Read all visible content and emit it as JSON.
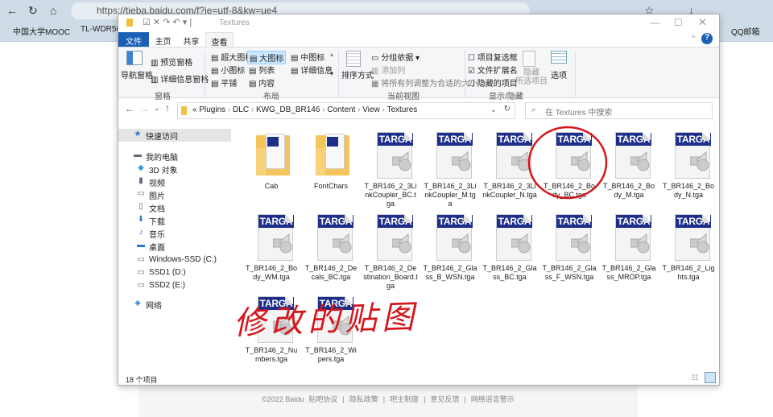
{
  "browser": {
    "url": "https://tieba.baidu.com/f?ie=utf-8&kw=ue4",
    "bookmarks": [
      "中国大学MOOC",
      "TL-WDR562",
      "QQ邮箱"
    ]
  },
  "footer": {
    "items": [
      "©2022 Baidu",
      "贴吧协议",
      "|",
      "隐私政策",
      "|",
      "吧主制度",
      "|",
      "意见反馈",
      "|",
      "网络谣言警示"
    ]
  },
  "explorer": {
    "title": "Textures",
    "tabs": [
      "文件",
      "主页",
      "共享",
      "查看"
    ],
    "ribbon": {
      "pane": {
        "nav": "导航窗格",
        "preview": "预览窗格",
        "details": "详细信息窗格",
        "group": "窗格"
      },
      "layout": {
        "items": [
          "超大图标",
          "大图标",
          "中图标",
          "小图标",
          "列表",
          "详细信息",
          "平铺",
          "内容"
        ],
        "selected": "大图标",
        "group": "布局"
      },
      "view": {
        "sort": "排序方式",
        "groupby": "分组依据",
        "addcol": "添加列",
        "fitcols": "将所有列调整为合适的大小",
        "group": "当前视图"
      },
      "show": {
        "checkboxes": "项目复选框",
        "extensions": "文件扩展名",
        "hidden": "隐藏的项目",
        "hide_selected": "隐藏\n所选项目",
        "options": "选项",
        "group": "显示/隐藏",
        "checked": {
          "checkboxes": false,
          "extensions": true,
          "hidden": false
        }
      }
    },
    "path": [
      "«",
      "Plugins",
      "DLC",
      "KWG_DB_BR146",
      "Content",
      "View",
      "Textures"
    ],
    "search_placeholder": "在 Textures 中搜索",
    "nav": [
      {
        "label": "快速访问",
        "icon": "star-icon"
      },
      {
        "label": "我的电脑",
        "icon": "computer-icon"
      },
      {
        "label": "3D 对象",
        "icon": "cube-icon"
      },
      {
        "label": "视频",
        "icon": "video-icon"
      },
      {
        "label": "图片",
        "icon": "picture-icon"
      },
      {
        "label": "文档",
        "icon": "document-icon"
      },
      {
        "label": "下载",
        "icon": "download-icon"
      },
      {
        "label": "音乐",
        "icon": "music-icon"
      },
      {
        "label": "桌面",
        "icon": "desktop-icon"
      },
      {
        "label": "Windows-SSD (C:)",
        "icon": "drive-icon"
      },
      {
        "label": "SSD1 (D:)",
        "icon": "drive-icon"
      },
      {
        "label": "SSD2 (E:)",
        "icon": "drive-icon"
      },
      {
        "label": "网络",
        "icon": "network-icon"
      }
    ],
    "files": [
      {
        "name": "Cab",
        "type": "folder"
      },
      {
        "name": "FontChars",
        "type": "folder"
      },
      {
        "name": "T_BR146_2_3LinkCoupler_BC.tga",
        "type": "targa"
      },
      {
        "name": "T_BR146_2_3LinkCoupler_M.tga",
        "type": "targa"
      },
      {
        "name": "T_BR146_2_3LinkCoupler_N.tga",
        "type": "targa"
      },
      {
        "name": "T_BR146_2_Body_BC.tga",
        "type": "targa",
        "circled": true
      },
      {
        "name": "T_BR146_2_Body_M.tga",
        "type": "targa"
      },
      {
        "name": "T_BR146_2_Body_N.tga",
        "type": "targa"
      },
      {
        "name": "T_BR146_2_Body_WM.tga",
        "type": "targa"
      },
      {
        "name": "T_BR146_2_Decals_BC.tga",
        "type": "targa"
      },
      {
        "name": "T_BR146_2_Destination_Board.tga",
        "type": "targa"
      },
      {
        "name": "T_BR146_2_Glass_B_WSN.tga",
        "type": "targa"
      },
      {
        "name": "T_BR146_2_Glass_BC.tga",
        "type": "targa"
      },
      {
        "name": "T_BR146_2_Glass_F_WSN.tga",
        "type": "targa"
      },
      {
        "name": "T_BR146_2_Glass_MROP.tga",
        "type": "targa"
      },
      {
        "name": "T_BR146_2_Lights.tga",
        "type": "targa"
      },
      {
        "name": "T_BR146_2_Numbers.tga",
        "type": "targa"
      },
      {
        "name": "T_BR146_2_Wipers.tga",
        "type": "targa"
      }
    ],
    "badge_text": "TARGA",
    "status": "18 个项目"
  },
  "annotation": {
    "text": "修改的贴图",
    "color": "#d4161c"
  }
}
